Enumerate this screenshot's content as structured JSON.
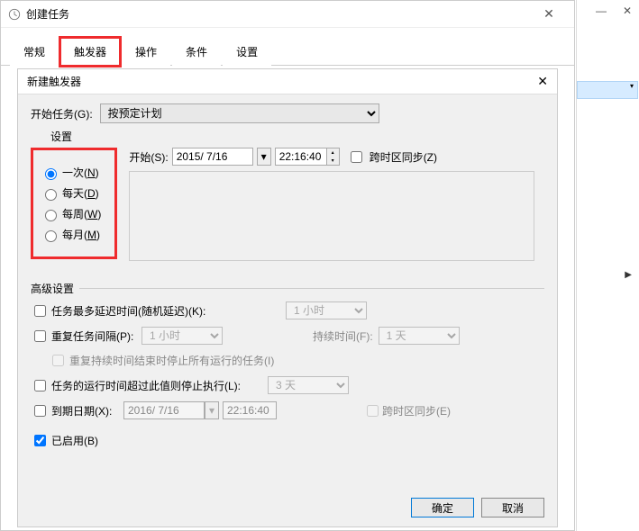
{
  "outer": {
    "title": "创建任务",
    "tabs": [
      "常规",
      "触发器",
      "操作",
      "条件",
      "设置"
    ],
    "active_tab": 1
  },
  "inner": {
    "title": "新建触发器",
    "start_label": "开始任务(G):",
    "start_value": "按预定计划",
    "settings_label": "设置",
    "freq": {
      "once": "一次(N)",
      "daily": "每天(D)",
      "weekly": "每周(W)",
      "monthly": "每月(M)"
    },
    "start": {
      "label": "开始(S):",
      "date": "2015/ 7/16",
      "time": "22:16:40",
      "tz_sync": "跨时区同步(Z)"
    },
    "advanced": {
      "legend": "高级设置",
      "delay_label": "任务最多延迟时间(随机延迟)(K):",
      "delay_value": "1 小时",
      "repeat_label": "重复任务间隔(P):",
      "repeat_value": "1 小时",
      "duration_label": "持续时间(F):",
      "duration_value": "1 天",
      "stop_at_end": "重复持续时间结束时停止所有运行的任务(I)",
      "stop_if_label": "任务的运行时间超过此值则停止执行(L):",
      "stop_if_value": "3 天",
      "expire_label": "到期日期(X):",
      "expire_date": "2016/ 7/16",
      "expire_time": "22:16:40",
      "expire_tz": "跨时区同步(E)",
      "enabled": "已启用(B)"
    },
    "buttons": {
      "ok": "确定",
      "cancel": "取消"
    }
  },
  "glyphs": {
    "close": "✕",
    "dash": "—",
    "square": "☐",
    "tri_right": "▶",
    "tri_down": "▾",
    "up": "▴",
    "down": "▾"
  }
}
